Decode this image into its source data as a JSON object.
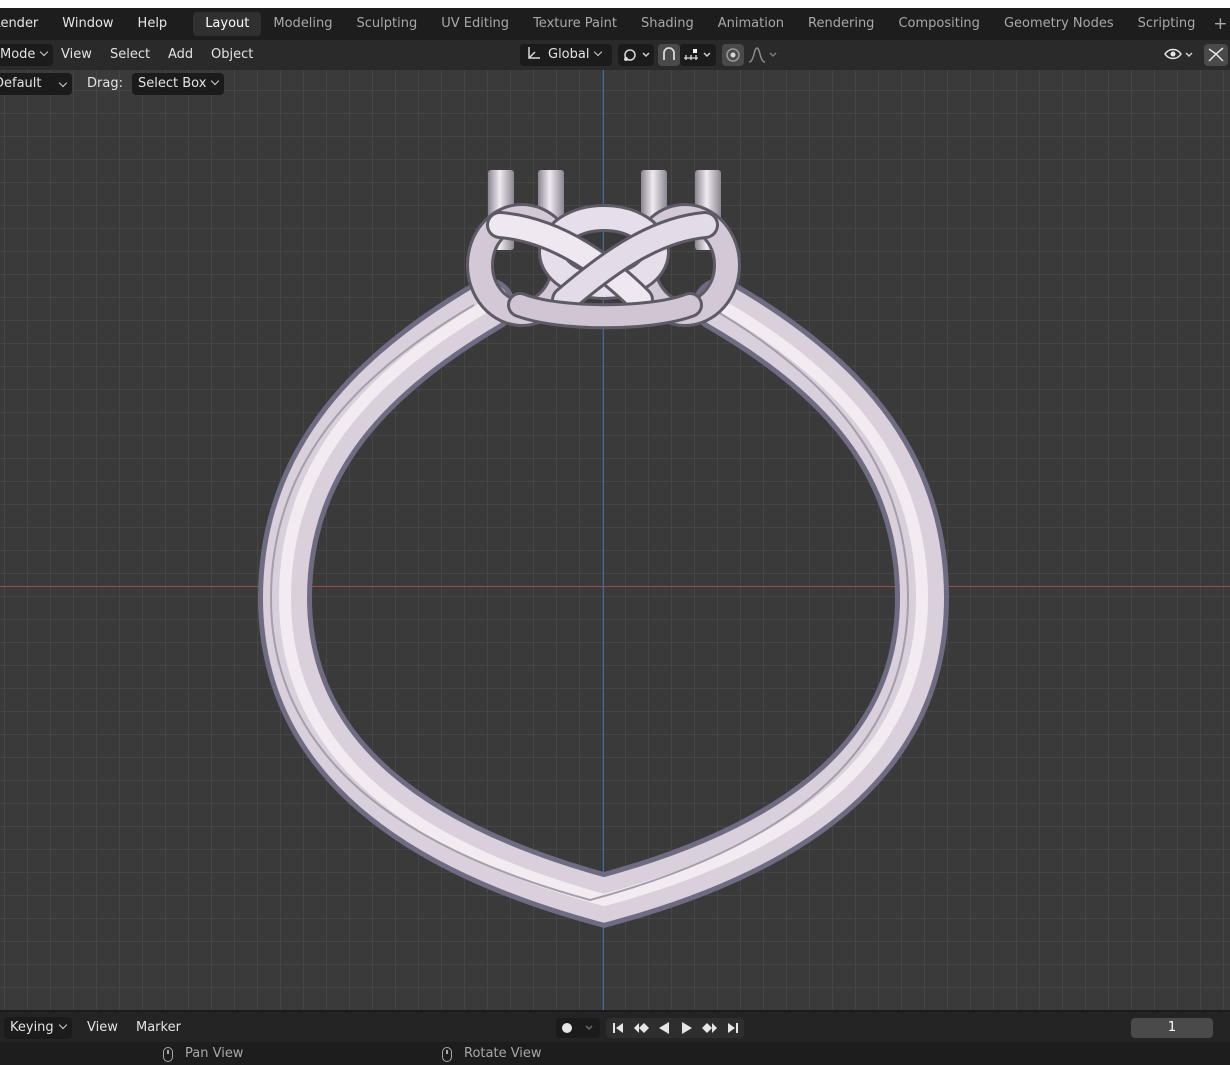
{
  "topbar": {
    "menus": [
      "Render",
      "Window",
      "Help"
    ],
    "workspaces": [
      "Layout",
      "Modeling",
      "Sculpting",
      "UV Editing",
      "Texture Paint",
      "Shading",
      "Animation",
      "Rendering",
      "Compositing",
      "Geometry Nodes",
      "Scripting"
    ],
    "active_workspace": "Layout",
    "add_label": "+"
  },
  "header": {
    "mode_label": "Mode",
    "menus": [
      "View",
      "Select",
      "Add",
      "Object"
    ],
    "orientation_label": "Global"
  },
  "tool_settings": {
    "orientation_value": "Default",
    "drag_label": "Drag:",
    "drag_value": "Select Box"
  },
  "timeline": {
    "keying_label": "Keying",
    "view_label": "View",
    "marker_label": "Marker",
    "current_frame": "1"
  },
  "statusbar": {
    "pan_view": "Pan View",
    "rotate_view": "Rotate View"
  },
  "colors": {
    "axis_x": "#a04a4a",
    "axis_y": "#3d6aa8",
    "active_workspace_bg": "#303030",
    "viewport_bg": "#3a3a3a"
  },
  "icons": [
    "transform-orientation-icon",
    "pivot-point-icon",
    "snap-icon",
    "snap-increment-icon",
    "proportional-editing-icon",
    "falloff-curve-icon",
    "visibility-eye-icon",
    "gizmo-toggle-icon",
    "record-icon",
    "jump-start-icon",
    "prev-keyframe-icon",
    "play-reverse-icon",
    "play-icon",
    "next-keyframe-icon",
    "jump-end-icon",
    "mouse-icon"
  ]
}
